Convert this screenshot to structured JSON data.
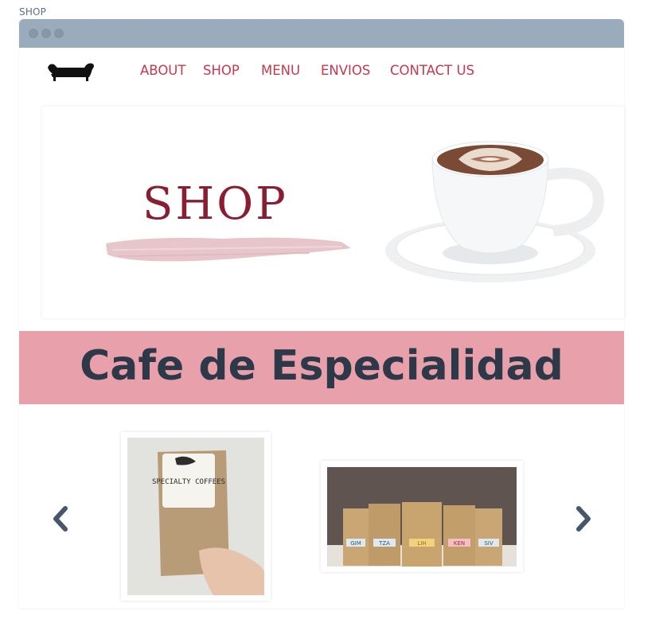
{
  "page": {
    "label": "SHOP"
  },
  "window": {
    "dots": [
      "dot",
      "dot",
      "dot"
    ]
  },
  "nav": {
    "logo_icon": "sofa-icon",
    "links": [
      {
        "label": "ABOUT"
      },
      {
        "label": "SHOP"
      },
      {
        "label": "MENU"
      },
      {
        "label": "ENVIOS"
      },
      {
        "label": "CONTACT US"
      }
    ]
  },
  "hero": {
    "title": "SHOP",
    "image": "coffee-cup-latte-art"
  },
  "band": {
    "title": "Cafe de Especialidad"
  },
  "carousel": {
    "prev_icon": "chevron-left-icon",
    "next_icon": "chevron-right-icon",
    "items": [
      {
        "image": "specialty-coffee-bag-photo",
        "label": "SPECIALTY COFFEES"
      },
      {
        "image": "coffee-bags-lineup-photo",
        "labels": [
          "GIM",
          "TZA",
          "LIH",
          "KEN",
          "SIV"
        ]
      }
    ]
  },
  "colors": {
    "nav_link": "#c4394f",
    "hero_title": "#8b1d33",
    "band_bg": "#e8a1ab",
    "band_text": "#2d3848",
    "titlebar": "#9aabbb"
  }
}
